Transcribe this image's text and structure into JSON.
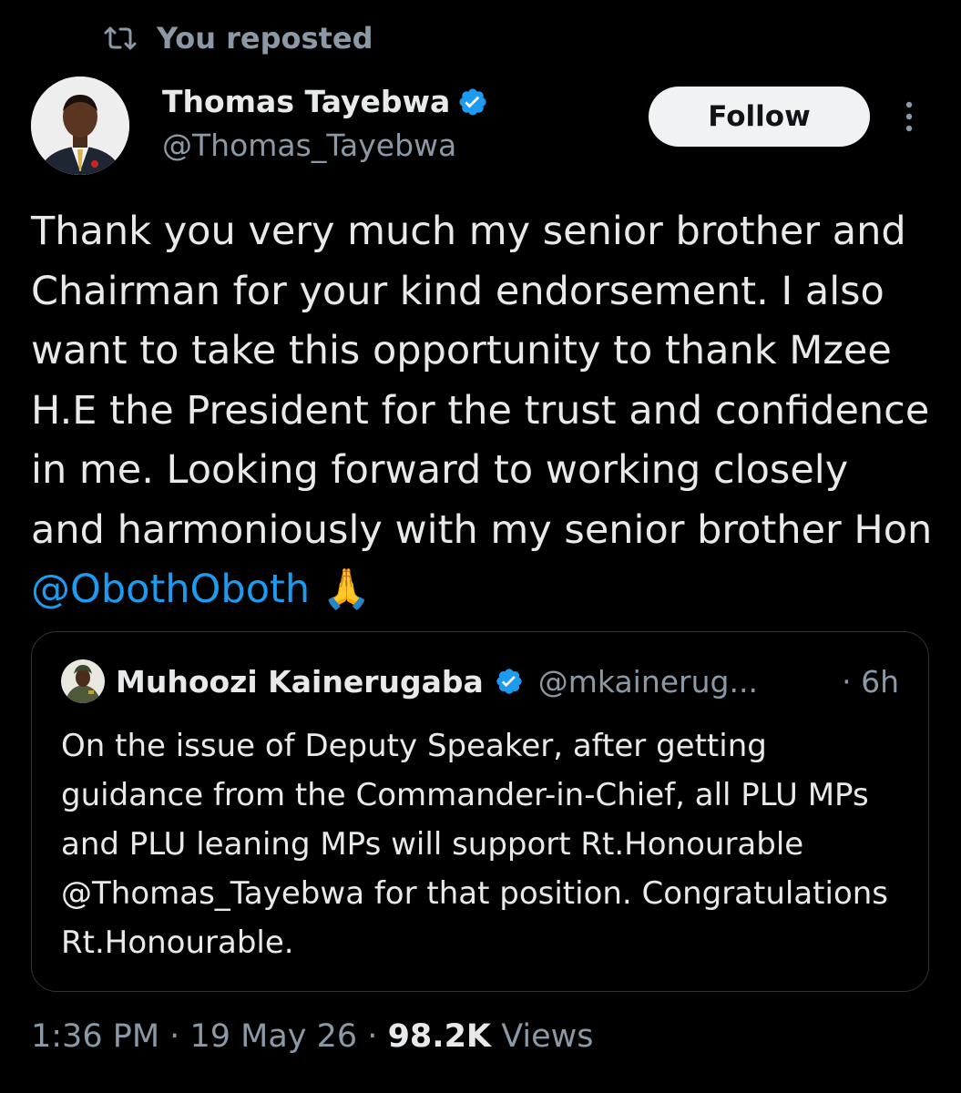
{
  "repost": {
    "label": "You reposted"
  },
  "author": {
    "name": "Thomas Tayebwa",
    "handle": "@Thomas_Tayebwa",
    "verified": true
  },
  "actions": {
    "follow_label": "Follow"
  },
  "tweet": {
    "text_before_mention": "Thank you very much my senior brother and Chairman for your kind endorsement. I also want to take this opportunity to thank Mzee H.E the President for the trust and confidence in me. Looking forward to working closely and harmoniously with my senior brother Hon ",
    "mention": "@ObothOboth",
    "emoji": "🙏"
  },
  "quote": {
    "name": "Muhoozi Kainerugaba",
    "handle": "@mkainerug...",
    "time": "· 6h",
    "text": "On the issue of Deputy Speaker, after getting guidance from the Commander-in-Chief, all PLU MPs and PLU leaning MPs will support Rt.Honourable @Thomas_Tayebwa for that position. Congratulations Rt.Honourable."
  },
  "meta": {
    "time": "1:36 PM",
    "date": "19 May 26",
    "separator": "·",
    "views_count": "98.2K",
    "views_label": "Views"
  },
  "colors": {
    "background": "#000000",
    "text_primary": "#e7e9ea",
    "text_secondary": "#8b98a5",
    "link": "#1d9bf0",
    "verified": "#1d9bf0",
    "follow_button_bg": "#eff3f4",
    "border": "#2f3336"
  },
  "icons": {
    "repost": "repost-icon",
    "verified": "verified-badge-icon",
    "more": "more-options-icon",
    "emoji": "folded-hands-emoji"
  }
}
